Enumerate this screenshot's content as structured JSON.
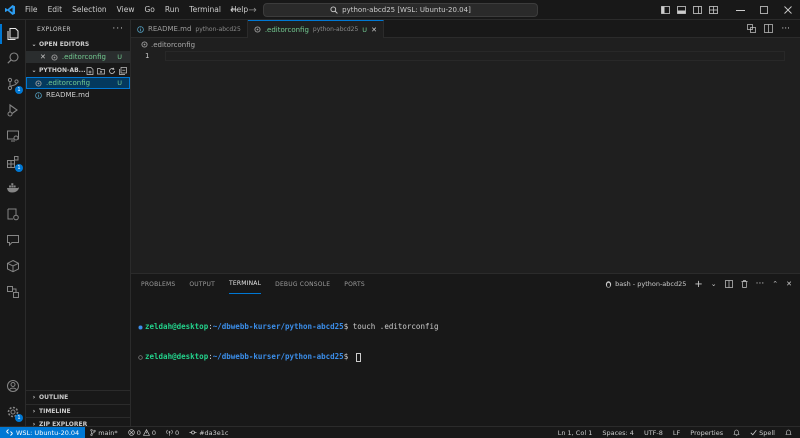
{
  "menu": [
    "File",
    "Edit",
    "Selection",
    "View",
    "Go",
    "Run",
    "Terminal",
    "Help"
  ],
  "command_center": {
    "text": "python-abcd25 [WSL: Ubuntu-20.04]"
  },
  "sidebar": {
    "title": "EXPLORER",
    "open_editors_label": "OPEN EDITORS",
    "open_editor_file": ".editorconfig",
    "open_editor_status": "U",
    "project_label": "PYTHON-AB...",
    "files": [
      {
        "name": ".editorconfig",
        "status": "U",
        "selected": true
      },
      {
        "name": "README.md",
        "status": "",
        "selected": false
      }
    ],
    "outline_label": "OUTLINE",
    "timeline_label": "TIMELINE",
    "zip_label": "ZIP EXPLORER"
  },
  "tabs": [
    {
      "name": "README.md",
      "desc": "python-abcd25",
      "active": false
    },
    {
      "name": ".editorconfig",
      "desc": "python-abcd25",
      "status": "U",
      "active": true
    }
  ],
  "breadcrumb": ".editorconfig",
  "editor": {
    "line_number": "1"
  },
  "panel": {
    "tabs": [
      "PROBLEMS",
      "OUTPUT",
      "TERMINAL",
      "DEBUG CONSOLE",
      "PORTS"
    ],
    "active_tab": "TERMINAL",
    "terminal_name": "bash - python-abcd25",
    "lines": [
      {
        "user": "zeldah@desktop",
        "sep": ":",
        "path": "~/dbwebb-kurser/python-abcd25",
        "prompt": "$ ",
        "cmd": "touch .editorconfig"
      },
      {
        "user": "zeldah@desktop",
        "sep": ":",
        "path": "~/dbwebb-kurser/python-abcd25",
        "prompt": "$ ",
        "cmd": ""
      }
    ]
  },
  "activity_badges": {
    "source_control": "1",
    "extensions": "1",
    "settings": "1"
  },
  "status": {
    "remote": "WSL: Ubuntu-20.04",
    "branch": "main*",
    "errors": "0",
    "warnings": "0",
    "ports": "0",
    "commit": "#da3e1c",
    "position": "Ln 1, Col 1",
    "spaces": "Spaces: 4",
    "encoding": "UTF-8",
    "eol": "LF",
    "language": "Properties",
    "spell": "Spell"
  },
  "colors": {
    "accent": "#0078d4",
    "untracked": "#73c991",
    "term_user": "#23d18b",
    "term_path": "#3b8eea"
  }
}
